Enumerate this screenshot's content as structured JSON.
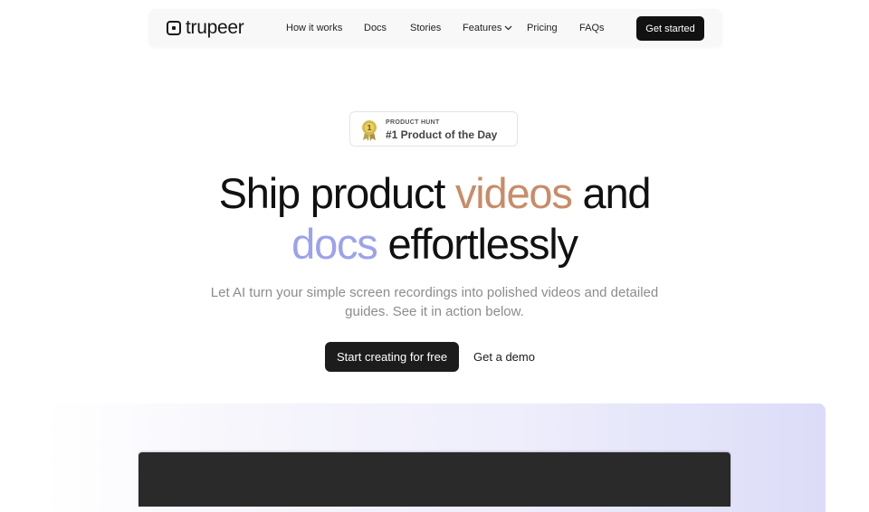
{
  "header": {
    "brand": "trupeer",
    "nav": [
      "How it works",
      "Docs",
      "Stories",
      "Features",
      "Pricing",
      "FAQs"
    ],
    "cta": "Get started"
  },
  "badge": {
    "label_top": "PRODUCT HUNT",
    "label_main": "#1 Product of the Day",
    "medal_number": "1"
  },
  "hero": {
    "line1_a": "Ship product ",
    "line1_b": "videos",
    "line1_c": " and",
    "line2_a": "docs",
    "line2_b": " effortlessly",
    "subtitle": "Let AI turn your simple screen recordings into polished videos and detailed guides. See it in action below.",
    "primary_cta": "Start creating for free",
    "secondary_cta": "Get a demo"
  },
  "colors": {
    "accent_orange": "#c88c68",
    "accent_purple": "#9da2ec",
    "primary_dark": "#1c1c1c"
  }
}
